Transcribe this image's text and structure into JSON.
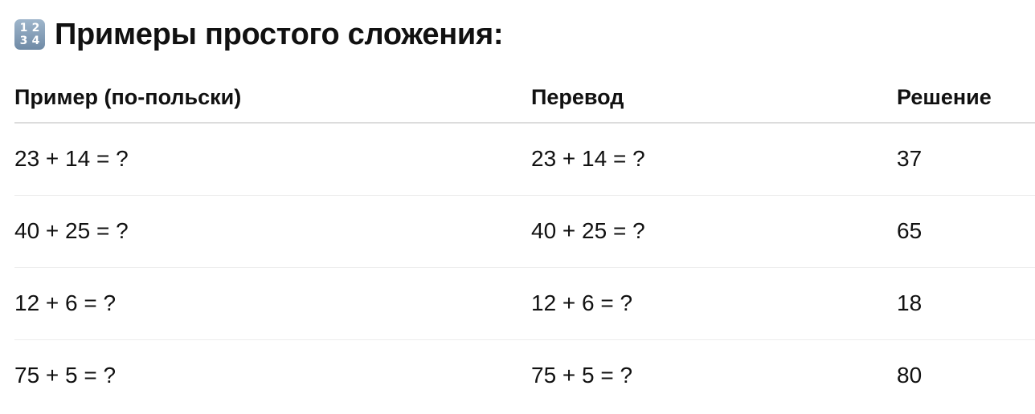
{
  "heading": {
    "icon": "input-numbers-icon",
    "icon_digits": [
      "1",
      "2",
      "3",
      "4"
    ],
    "title": "Примеры простого сложения:"
  },
  "table": {
    "columns": [
      "Пример (по-польски)",
      "Перевод",
      "Решение"
    ],
    "rows": [
      [
        "23 + 14 = ?",
        "23 + 14 = ?",
        "37"
      ],
      [
        "40 + 25 = ?",
        "40 + 25 = ?",
        "65"
      ],
      [
        "12 + 6 = ?",
        "12 + 6 = ?",
        "18"
      ],
      [
        "75 + 5 = ?",
        "75 + 5 = ?",
        "80"
      ]
    ]
  }
}
